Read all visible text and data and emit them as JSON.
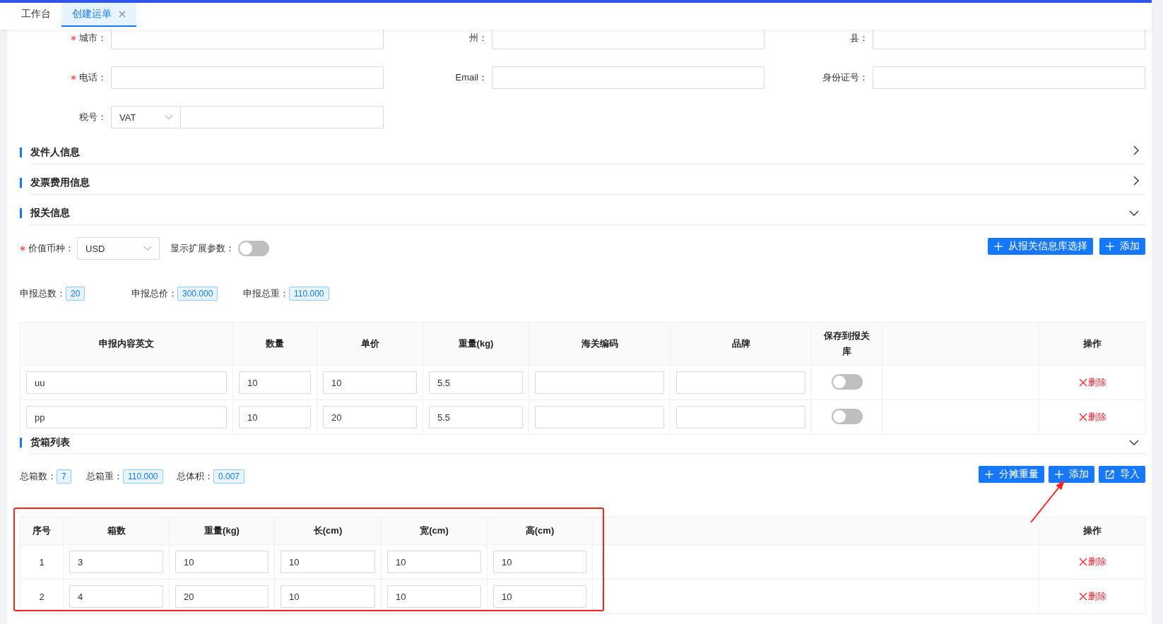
{
  "tabs": [
    {
      "label": "工作台",
      "selected": false,
      "closable": false
    },
    {
      "label": "创建运单",
      "selected": true,
      "closable": true
    }
  ],
  "recipient_form": {
    "fields": [
      {
        "label": "城市：",
        "required": true,
        "kind": "text"
      },
      {
        "label": "州：",
        "required": false,
        "kind": "text"
      },
      {
        "label": "县：",
        "required": false,
        "kind": "text"
      },
      {
        "label": "电话：",
        "required": true,
        "kind": "text"
      },
      {
        "label": "Email：",
        "required": false,
        "kind": "text"
      },
      {
        "label": "身份证号：",
        "required": false,
        "kind": "text"
      },
      {
        "label": "税号：",
        "required": false,
        "kind": "tax",
        "select_value": "VAT"
      }
    ]
  },
  "sections": [
    {
      "title": "发件人信息",
      "expanded": false
    },
    {
      "title": "发票费用信息",
      "expanded": false
    }
  ],
  "customs": {
    "section": {
      "title": "报关信息",
      "expanded": true
    },
    "currency": {
      "label": "价值币种：",
      "required": true,
      "value": "USD"
    },
    "extend_toggle": {
      "label": "显示扩展参数：",
      "on": false
    },
    "buttons": [
      {
        "label": "从报关信息库选择"
      },
      {
        "label": "添加"
      }
    ],
    "totals": [
      {
        "label": "申报总数：",
        "value": "20"
      },
      {
        "label": "申报总价：",
        "value": "300.000"
      },
      {
        "label": "申报总重：",
        "value": "110.000"
      }
    ],
    "table": {
      "columns": [
        {
          "label": "申报内容英文",
          "kind": "input"
        },
        {
          "label": "数量",
          "kind": "input"
        },
        {
          "label": "单价",
          "kind": "input"
        },
        {
          "label": "重量(kg)",
          "kind": "input"
        },
        {
          "label": "海关编码",
          "kind": "input"
        },
        {
          "label": "品牌",
          "kind": "input"
        },
        {
          "label": "保存到报关库",
          "kind": "toggle"
        },
        {
          "kind": "blank"
        },
        {
          "label": "操作",
          "kind": "action"
        }
      ],
      "rows": [
        {
          "cells": [
            "uu",
            "10",
            "10",
            "5.5"
          ],
          "save_to_library": false,
          "action": "删除"
        },
        {
          "cells": [
            "pp",
            "10",
            "20",
            "5.5"
          ],
          "save_to_library": false,
          "action": "删除"
        }
      ]
    }
  },
  "cargo": {
    "section": {
      "title": "货箱列表",
      "expanded": true
    },
    "totals": [
      {
        "label": "总箱数：",
        "value": "7"
      },
      {
        "label": "总箱重：",
        "value": "110.000"
      },
      {
        "label": "总体积：",
        "value": "0.007"
      }
    ],
    "buttons": [
      {
        "label": "分摊重量"
      },
      {
        "label": "添加"
      },
      {
        "label": "导入"
      }
    ],
    "table": {
      "columns": [
        {
          "label": "序号",
          "kind": "index"
        },
        {
          "label": "箱数",
          "kind": "input"
        },
        {
          "label": "重量(kg)",
          "kind": "input"
        },
        {
          "label": "长(cm)",
          "kind": "input"
        },
        {
          "label": "宽(cm)",
          "kind": "input"
        },
        {
          "label": "高(cm)",
          "kind": "input"
        },
        {
          "kind": "blank"
        },
        {
          "label": "操作",
          "kind": "action"
        }
      ],
      "rows": [
        {
          "cells": [
            "1",
            "3",
            "10",
            "10",
            "10",
            "10"
          ],
          "action": "删除"
        },
        {
          "cells": [
            "2",
            "4",
            "20",
            "10",
            "10",
            "10"
          ],
          "action": "删除"
        }
      ]
    }
  }
}
